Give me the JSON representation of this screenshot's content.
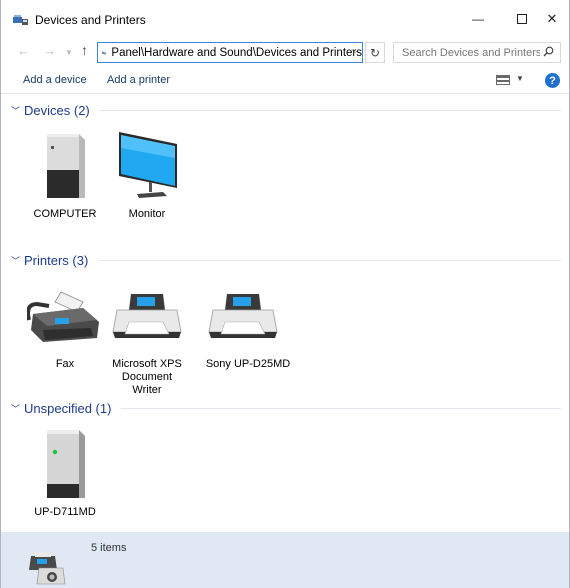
{
  "window": {
    "title": "Devices and Printers",
    "min_glyph": "—",
    "close_glyph": "✕"
  },
  "address": {
    "path": "Panel\\Hardware and Sound\\Devices and Printers",
    "search_placeholder": "Search Devices and Printers"
  },
  "toolbar": {
    "add_device": "Add a device",
    "add_printer": "Add a printer"
  },
  "groups": {
    "devices": {
      "title": "Devices (2)",
      "items": [
        {
          "label": "COMPUTER",
          "icon": "computer-tower-icon"
        },
        {
          "label": "Monitor",
          "icon": "monitor-icon"
        }
      ]
    },
    "printers": {
      "title": "Printers (3)",
      "items": [
        {
          "label": "Fax",
          "icon": "fax-icon"
        },
        {
          "label": "Microsoft XPS Document Writer",
          "line1": "Microsoft XPS",
          "line2": "Document Writer",
          "icon": "printer-icon"
        },
        {
          "label": "Sony UP-D25MD",
          "icon": "printer-icon"
        }
      ]
    },
    "unspecified": {
      "title": "Unspecified (1)",
      "items": [
        {
          "label": "UP-D711MD",
          "icon": "device-tower-icon"
        }
      ]
    }
  },
  "status": {
    "count": "5 items"
  },
  "colors": {
    "accent": "#1e3b8a",
    "status_bg": "#dfe8f3",
    "address_border": "#3a87d8"
  }
}
